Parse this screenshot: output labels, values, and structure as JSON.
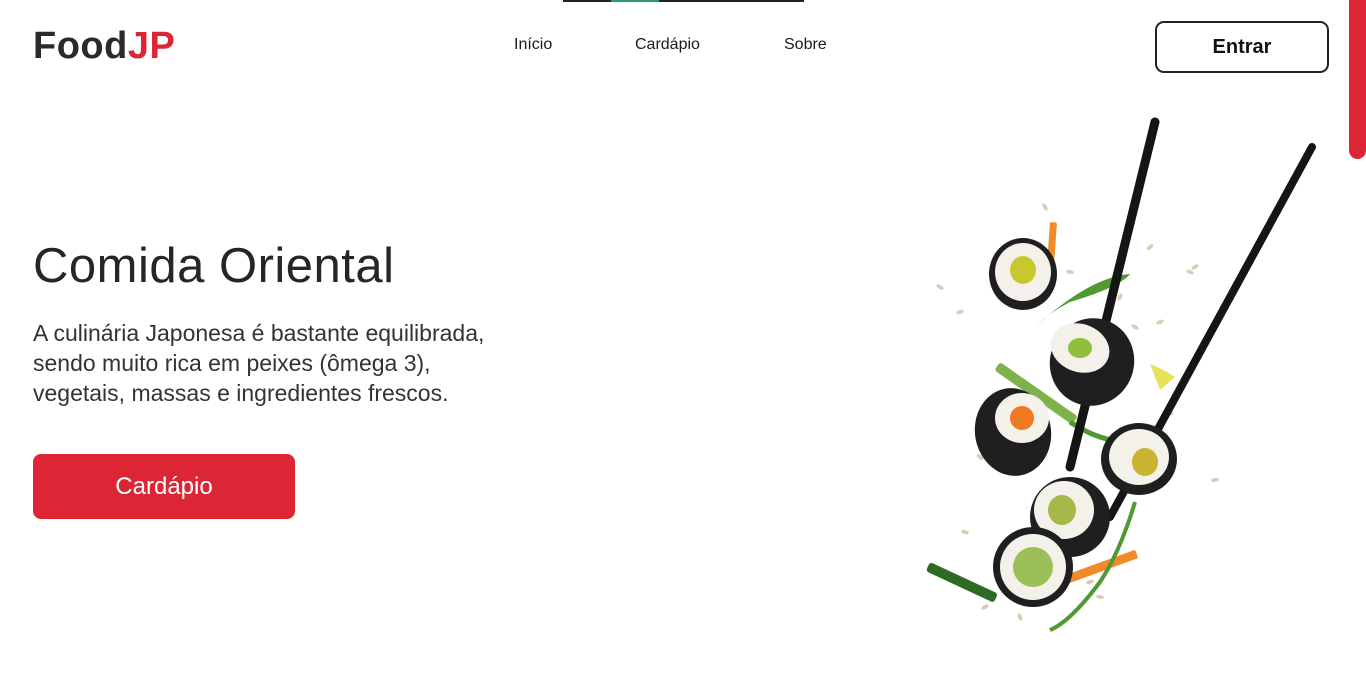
{
  "header": {
    "logo": {
      "part1": "Food",
      "part2": "JP"
    },
    "nav": [
      {
        "label": "Início"
      },
      {
        "label": "Cardápio"
      },
      {
        "label": "Sobre"
      }
    ],
    "login_label": "Entrar"
  },
  "hero": {
    "title": "Comida Oriental",
    "description_lines": [
      "A culinária Japonesa é bastante equilibrada,",
      "sendo muito rica em peixes (ômega 3),",
      "vegetais, massas e ingredientes frescos."
    ],
    "cta_label": "Cardápio",
    "image_icon": "sushi-chopsticks-image"
  },
  "colors": {
    "brand_red": "#dc2535",
    "text_dark": "#2a2a2a",
    "accent_green": "#2e9d6b"
  }
}
